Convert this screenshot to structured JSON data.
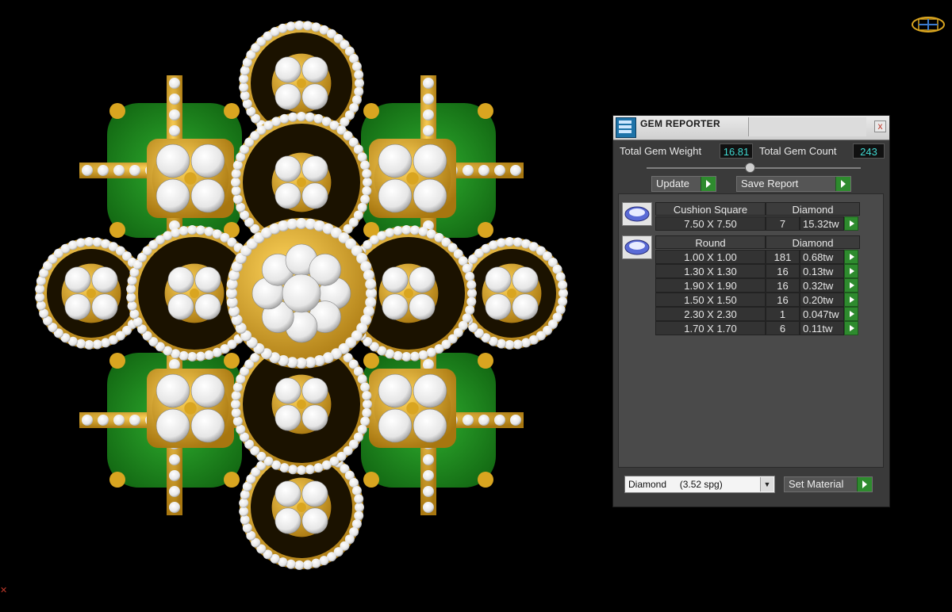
{
  "viewport": {
    "description_icon": "jewelry-3d-model",
    "colors": {
      "background": "#000000",
      "gold": "#d9a520",
      "gold_dark": "#8a6414",
      "emerald": "#1f8f1f",
      "diamond": "#f2f2f2"
    }
  },
  "nav_gizmo": {
    "icon": "view-cube-icon"
  },
  "panel": {
    "title": "GEM REPORTER",
    "close_label": "x",
    "total_gem_weight_label": "Total Gem Weight",
    "total_gem_weight_value": "16.81",
    "total_gem_count_label": "Total Gem Count",
    "total_gem_count_value": "243",
    "update_label": "Update",
    "save_report_label": "Save Report",
    "groups": [
      {
        "shape": "Cushion Square",
        "material": "Diamond",
        "rows": [
          {
            "size": "7.50 X 7.50",
            "count": "7",
            "weight": "15.32tw"
          }
        ]
      },
      {
        "shape": "Round",
        "material": "Diamond",
        "rows": [
          {
            "size": "1.00 X 1.00",
            "count": "181",
            "weight": "0.68tw"
          },
          {
            "size": "1.30 X 1.30",
            "count": "16",
            "weight": "0.13tw"
          },
          {
            "size": "1.90 X 1.90",
            "count": "16",
            "weight": "0.32tw"
          },
          {
            "size": "1.50 X 1.50",
            "count": "16",
            "weight": "0.20tw"
          },
          {
            "size": "2.30 X 2.30",
            "count": "1",
            "weight": "0.047tw"
          },
          {
            "size": "1.70 X 1.70",
            "count": "6",
            "weight": "0.11tw"
          }
        ]
      }
    ],
    "material_select_value": "Diamond     (3.52 spg)",
    "set_material_label": "Set Material",
    "accent_green": "#2e8b2e",
    "value_cyan": "#3fd7d0"
  }
}
